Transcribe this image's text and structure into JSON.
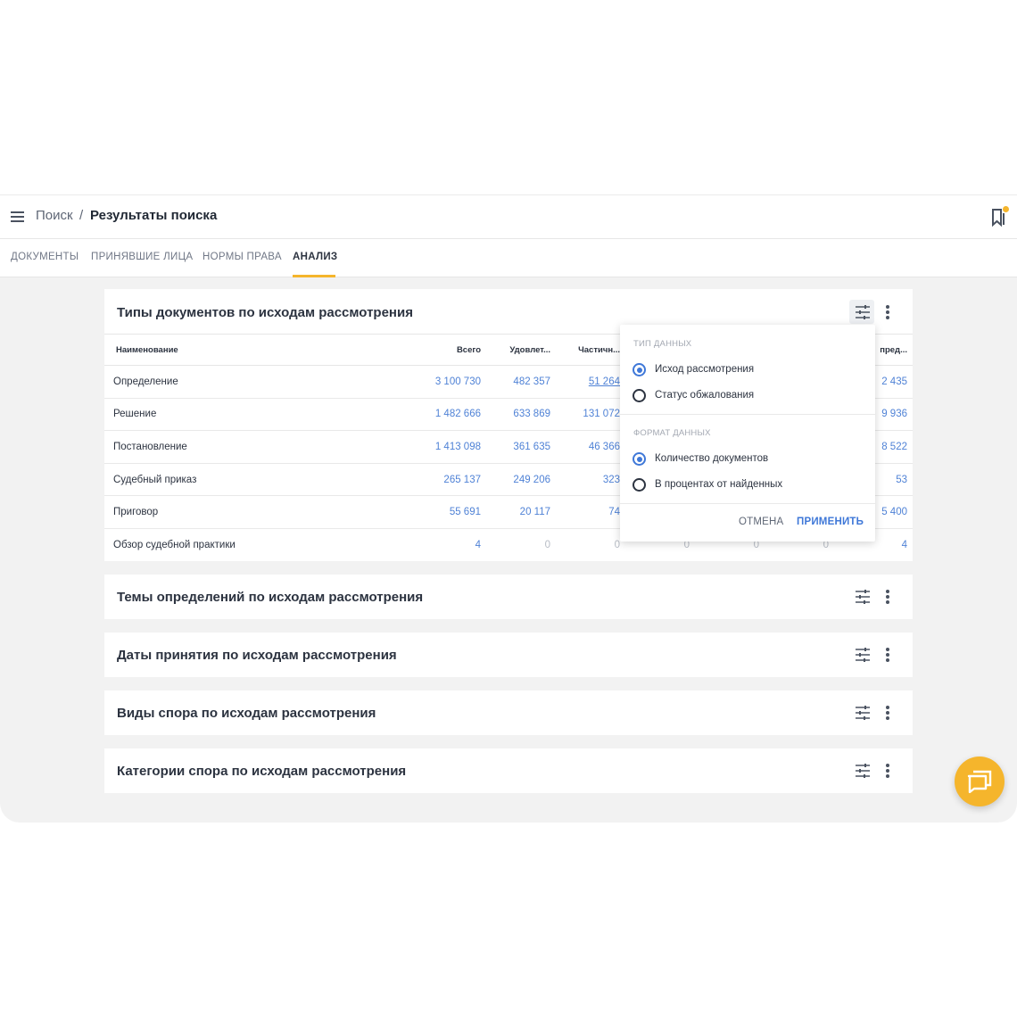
{
  "header": {
    "breadcrumb_root": "Поиск",
    "breadcrumb_separator": "/",
    "breadcrumb_current": "Результаты поиска"
  },
  "tabs": [
    {
      "label": "ДОКУМЕНТЫ",
      "active": false
    },
    {
      "label": "ПРИНЯВШИЕ ЛИЦА",
      "active": false
    },
    {
      "label": "НОРМЫ ПРАВА",
      "active": false
    },
    {
      "label": "АНАЛИЗ",
      "active": true
    }
  ],
  "colors": {
    "accent": "#f5b52c",
    "link": "#4f82d6",
    "radio_selected": "#3f78d8"
  },
  "main_card": {
    "title": "Типы документов по исходам рассмотрения",
    "columns": [
      "Наименование",
      "Всего",
      "Удовлет...",
      "Частичн...",
      "",
      "",
      "",
      "пред..."
    ],
    "rows": [
      {
        "name": "Определение",
        "cells": [
          "3 100 730",
          "482 357",
          "51 264",
          "",
          "",
          "",
          "2 435"
        ]
      },
      {
        "name": "Решение",
        "cells": [
          "1 482 666",
          "633 869",
          "131 072",
          "",
          "",
          "",
          "9 936"
        ]
      },
      {
        "name": "Постановление",
        "cells": [
          "1 413 098",
          "361 635",
          "46 366",
          "",
          "",
          "",
          "8 522"
        ]
      },
      {
        "name": "Судебный приказ",
        "cells": [
          "265 137",
          "249 206",
          "323",
          "",
          "",
          "",
          "53"
        ]
      },
      {
        "name": "Приговор",
        "cells": [
          "55 691",
          "20 117",
          "74",
          "",
          "",
          "",
          "5 400"
        ]
      },
      {
        "name": "Обзор судебной практики",
        "cells": [
          "4",
          "0",
          "0",
          "0",
          "0",
          "0",
          "4"
        ]
      }
    ]
  },
  "popup": {
    "section1_title": "ТИП ДАННЫХ",
    "section1_options": [
      "Исход рассмотрения",
      "Статус обжалования"
    ],
    "section1_selected": 0,
    "section2_title": "ФОРМАТ ДАННЫХ",
    "section2_options": [
      "Количество документов",
      "В процентах от найденных"
    ],
    "section2_selected": 0,
    "cancel_label": "ОТМЕНА",
    "apply_label": "ПРИМЕНИТЬ"
  },
  "collapsed_cards": [
    {
      "title": "Темы определений по исходам рассмотрения"
    },
    {
      "title": "Даты принятия по исходам рассмотрения"
    },
    {
      "title": "Виды спора по исходам рассмотрения"
    },
    {
      "title": "Категории спора по исходам рассмотрения"
    }
  ],
  "icons": {
    "menu": "hamburger-icon",
    "bookmark": "bookmark-icon",
    "tune": "tune-icon",
    "more": "more-vertical-icon",
    "chat": "chat-icon"
  }
}
